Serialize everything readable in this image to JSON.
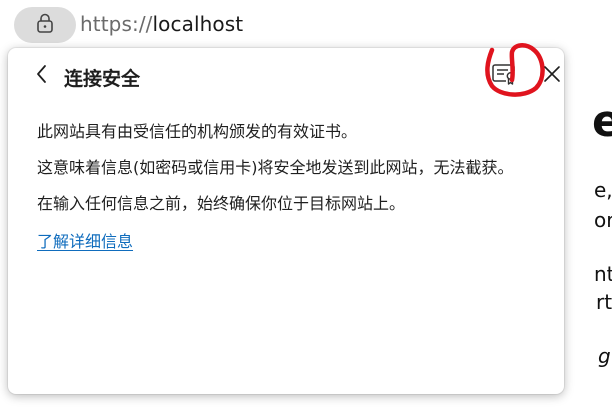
{
  "address_bar": {
    "url_scheme": "https://",
    "url_host": "localhost",
    "lock_icon": "lock-icon"
  },
  "flyout": {
    "back_icon": "chevron-left-icon",
    "title": "连接安全",
    "certificate_icon": "certificate-icon",
    "close_icon": "close-icon",
    "annotation_color": "#e0141e",
    "paragraphs": [
      "此网站具有由受信任的机构颁发的有效证书。",
      "这意味着信息(如密码或信用卡)将安全地发送到此网站，无法截获。",
      "在输入任何信息之前，始终确保你位于目标网站上。"
    ],
    "learn_more": "了解详细信息"
  },
  "background_page": {
    "fragments": [
      "e",
      "e,",
      "or",
      "nt",
      "rt",
      "g"
    ]
  }
}
